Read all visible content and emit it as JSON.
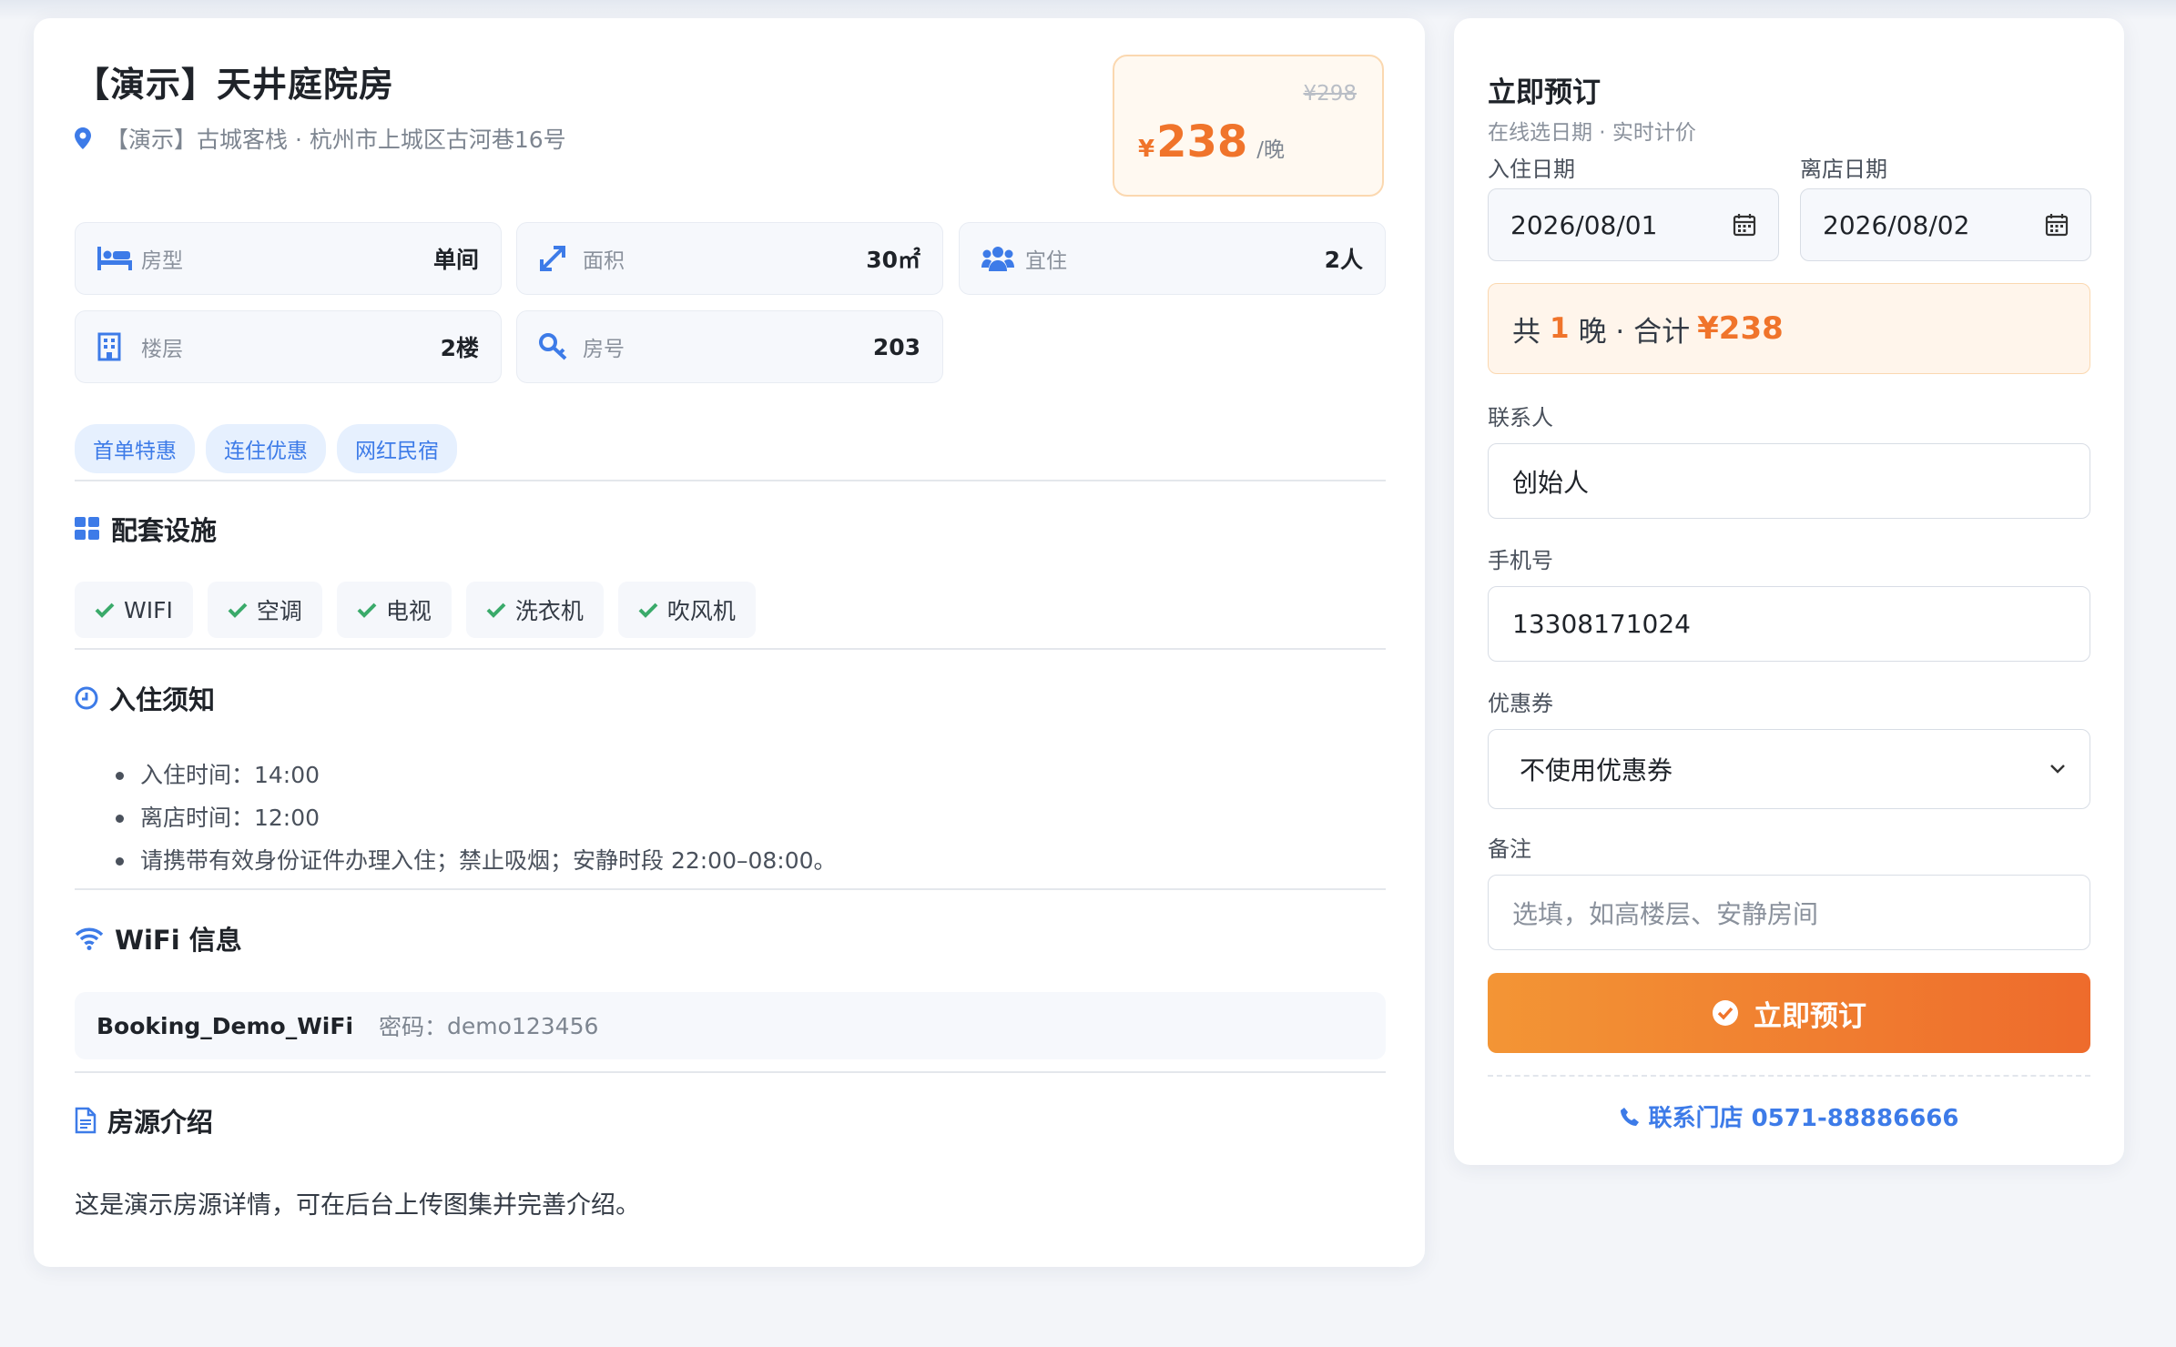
{
  "room": {
    "title": "【演示】天井庭院房",
    "address": "【演示】古城客栈 · 杭州市上城区古河巷16号",
    "original_price": "¥298",
    "currency": "¥",
    "price": "238",
    "price_unit": "/晚"
  },
  "info": [
    {
      "icon": "bed-icon",
      "label": "房型",
      "value": "单间"
    },
    {
      "icon": "area-arrows-icon",
      "label": "面积",
      "value": "30㎡"
    },
    {
      "icon": "users-icon",
      "label": "宜住",
      "value": "2人"
    },
    {
      "icon": "building-icon",
      "label": "楼层",
      "value": "2楼"
    },
    {
      "icon": "key-icon",
      "label": "房号",
      "value": "203"
    }
  ],
  "tags": [
    "首单特惠",
    "连住优惠",
    "网红民宿"
  ],
  "facilities": {
    "title": "配套设施",
    "items": [
      "WIFI",
      "空调",
      "电视",
      "洗衣机",
      "吹风机"
    ]
  },
  "notice": {
    "title": "入住须知",
    "items": [
      "入住时间：14:00",
      "离店时间：12:00",
      "请携带有效身份证件办理入住；禁止吸烟；安静时段 22:00–08:00。"
    ]
  },
  "wifi": {
    "title": "WiFi 信息",
    "ssid": "Booking_Demo_WiFi",
    "password_label": "密码：",
    "password": "demo123456"
  },
  "intro": {
    "title": "房源介绍",
    "text": "这是演示房源详情，可在后台上传图集并完善介绍。"
  },
  "booking": {
    "title": "立即预订",
    "subtitle": "在线选日期 · 实时计价",
    "checkin_label": "入住日期",
    "checkin_value": "2026/08/01",
    "checkout_label": "离店日期",
    "checkout_value": "2026/08/02",
    "summary_prefix": "共",
    "nights": "1",
    "summary_mid": "晚 · 合计",
    "total": "¥238",
    "contact_label": "联系人",
    "contact_value": "创始人",
    "phone_label": "手机号",
    "phone_value": "13308171024",
    "coupon_label": "优惠券",
    "coupon_value": "不使用优惠券",
    "remark_label": "备注",
    "remark_placeholder": "选填，如高楼层、安静房间",
    "submit_label": "立即预订",
    "store_contact": "联系门店 0571-88886666"
  },
  "colors": {
    "accent": "#f0742b",
    "primary": "#3d7be8",
    "check": "#3aaa6a"
  }
}
